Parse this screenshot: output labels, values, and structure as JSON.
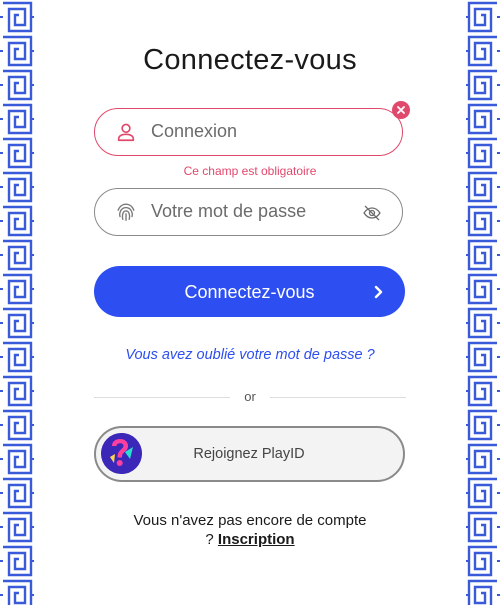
{
  "title": "Connectez-vous",
  "login_field": {
    "placeholder": "Connexion",
    "value": "",
    "error": "Ce champ est obligatoire"
  },
  "password_field": {
    "placeholder": "Votre mot de passe",
    "value": ""
  },
  "login_button": {
    "label": "Connectez-vous"
  },
  "forgot_password": "Vous avez oublié votre mot de passe ?",
  "separator": "or",
  "playid_button": {
    "label": "Rejoignez PlayID"
  },
  "signup": {
    "prompt_line1": "Vous n'avez pas encore de compte",
    "prompt_line2": "?",
    "link": "Inscription"
  },
  "colors": {
    "accent": "#2d4ef0",
    "error": "#e0486c",
    "border_pattern": "#3a5bd9"
  },
  "icons": {
    "login_field": "user-icon",
    "password_field": "fingerprint-icon",
    "clear": "close-icon",
    "visibility": "eye-off-icon",
    "login_button": "chevron-right-icon",
    "playid": "playid-logo"
  }
}
